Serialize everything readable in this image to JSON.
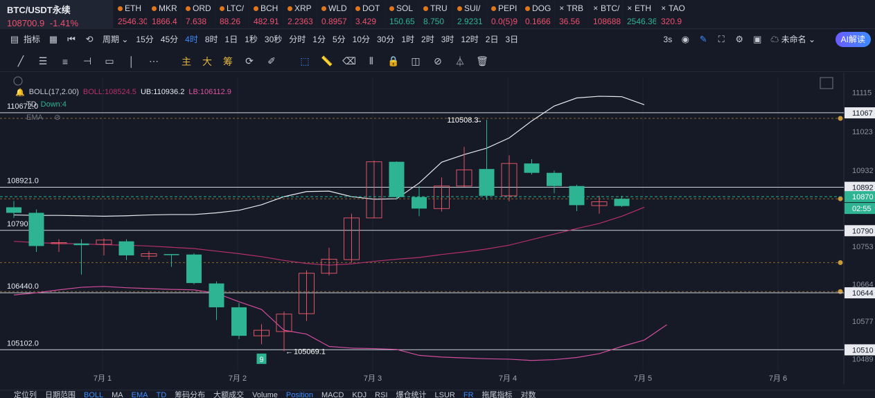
{
  "main_ticker": {
    "symbol": "BTC/USDT永续",
    "price": "108700.9",
    "change": "-1.41%"
  },
  "tickers": [
    {
      "name": "ETH",
      "price": "2546.30",
      "dir": "dn",
      "icon": "coin-icon"
    },
    {
      "name": "MKR",
      "price": "1866.4",
      "dir": "dn",
      "icon": "coin-icon"
    },
    {
      "name": "ORD",
      "price": "7.638",
      "dir": "dn",
      "icon": "coin-icon"
    },
    {
      "name": "LTC/",
      "price": "88.26",
      "dir": "dn",
      "icon": "coin-icon"
    },
    {
      "name": "BCH",
      "price": "482.91",
      "dir": "dn",
      "icon": "coin-icon"
    },
    {
      "name": "XRP",
      "price": "2.2363",
      "dir": "dn",
      "icon": "coin-icon"
    },
    {
      "name": "WLD",
      "price": "0.8957",
      "dir": "dn",
      "icon": "coin-icon"
    },
    {
      "name": "DOT",
      "price": "3.429",
      "dir": "dn",
      "icon": "coin-icon"
    },
    {
      "name": "SOL",
      "price": "150.65",
      "dir": "up",
      "icon": "coin-icon"
    },
    {
      "name": "TRU",
      "price": "8.750",
      "dir": "up",
      "icon": "coin-icon"
    },
    {
      "name": "SUI/",
      "price": "2.9231",
      "dir": "up",
      "icon": "coin-icon"
    },
    {
      "name": "PEPI",
      "price": "0.0(5)9",
      "dir": "dn",
      "icon": "coin-icon"
    },
    {
      "name": "DOG",
      "price": "0.1666",
      "dir": "dn",
      "icon": "coin-icon"
    },
    {
      "name": "TRB",
      "price": "36.56",
      "dir": "dn",
      "icon": "x-icon"
    },
    {
      "name": "BTC/",
      "price": "108688",
      "dir": "dn",
      "icon": "x-icon"
    },
    {
      "name": "ETH",
      "price": "2546.36",
      "dir": "up",
      "icon": "x-icon"
    },
    {
      "name": "TAO",
      "price": "320.9",
      "dir": "dn",
      "icon": "x-icon"
    }
  ],
  "toolbar": {
    "indicator_label": "指标",
    "period_label": "周期",
    "intervals": [
      "15分",
      "45分",
      "4时",
      "8时",
      "1日",
      "1秒",
      "30秒",
      "分时",
      "1分",
      "5分",
      "10分",
      "30分",
      "1时",
      "2时",
      "3时",
      "12时",
      "2日",
      "3日"
    ],
    "active_interval": "4时",
    "right_interval": "3s",
    "layout_name": "未命名",
    "ai_label": "AI解读"
  },
  "draw_tools": {
    "main": "主",
    "big": "大",
    "chips": "筹"
  },
  "legend": {
    "boll_name": "BOLL(17,2.00)",
    "boll_value": "BOLL:108524.5",
    "ub": "UB:110936.2",
    "lb": "LB:106112.9",
    "td_name": "TD",
    "td_value": "Down:4",
    "ema_name": "EMA"
  },
  "colors": {
    "up": "#2fb493",
    "down": "#f0506e",
    "accent": "#3d8bfd",
    "boll_mid": "#b8306b",
    "bands": "#e8eaf0"
  },
  "chart_data": {
    "type": "candlestick",
    "symbol": "BTC/USDT",
    "interval": "4时",
    "ylim": [
      104700,
      111500
    ],
    "x_labels": [
      "7月 1",
      "7月 2",
      "7月 3",
      "7月 4",
      "7月 5",
      "7月 6"
    ],
    "axis_ticks": [
      "11115",
      "11067",
      "11023",
      "10932",
      "10892",
      "10870",
      "10790",
      "10753",
      "10664",
      "10644",
      "10577",
      "10510",
      "10489"
    ],
    "candles": [
      {
        "o": 108450,
        "h": 108600,
        "l": 108200,
        "c": 108320
      },
      {
        "o": 108320,
        "h": 108400,
        "l": 107400,
        "c": 107540
      },
      {
        "o": 107600,
        "h": 107700,
        "l": 107400,
        "c": 107620
      },
      {
        "o": 107600,
        "h": 107700,
        "l": 106870,
        "c": 107560
      },
      {
        "o": 107580,
        "h": 107720,
        "l": 107320,
        "c": 107680
      },
      {
        "o": 107650,
        "h": 107700,
        "l": 107210,
        "c": 107320
      },
      {
        "o": 107300,
        "h": 107420,
        "l": 107220,
        "c": 107360
      },
      {
        "o": 107350,
        "h": 107350,
        "l": 107050,
        "c": 107340
      },
      {
        "o": 107340,
        "h": 107370,
        "l": 106640,
        "c": 106670
      },
      {
        "o": 106660,
        "h": 106710,
        "l": 105800,
        "c": 106100
      },
      {
        "o": 106100,
        "h": 106200,
        "l": 105350,
        "c": 105430
      },
      {
        "o": 105430,
        "h": 105700,
        "l": 105230,
        "c": 105560
      },
      {
        "o": 105530,
        "h": 106000,
        "l": 105069,
        "c": 105940
      },
      {
        "o": 105950,
        "h": 106970,
        "l": 105780,
        "c": 106900
      },
      {
        "o": 106900,
        "h": 107500,
        "l": 106850,
        "c": 107230
      },
      {
        "o": 107220,
        "h": 108300,
        "l": 107150,
        "c": 108200
      },
      {
        "o": 108200,
        "h": 109550,
        "l": 108200,
        "c": 109520
      },
      {
        "o": 109520,
        "h": 109530,
        "l": 108630,
        "c": 108690
      },
      {
        "o": 108690,
        "h": 108950,
        "l": 108240,
        "c": 108420
      },
      {
        "o": 108420,
        "h": 109150,
        "l": 108350,
        "c": 108950
      },
      {
        "o": 108950,
        "h": 109870,
        "l": 108930,
        "c": 109330
      },
      {
        "o": 109350,
        "h": 110508.3,
        "l": 108620,
        "c": 108720
      },
      {
        "o": 108720,
        "h": 109670,
        "l": 108590,
        "c": 109480
      },
      {
        "o": 109480,
        "h": 109580,
        "l": 109220,
        "c": 109260
      },
      {
        "o": 109260,
        "h": 109310,
        "l": 108780,
        "c": 108950
      },
      {
        "o": 108950,
        "h": 108980,
        "l": 108360,
        "c": 108500
      },
      {
        "o": 108490,
        "h": 108720,
        "l": 108300,
        "c": 108580
      },
      {
        "o": 108650,
        "h": 108720,
        "l": 108460,
        "c": 108480
      }
    ],
    "boll_upper": [
      108270,
      108260,
      108260,
      108250,
      108240,
      108250,
      108270,
      108280,
      108280,
      108320,
      108380,
      108510,
      108700,
      108820,
      108830,
      108700,
      108640,
      108650,
      109020,
      109510,
      109690,
      109840,
      110080,
      110480,
      110830,
      111020,
      111060,
      111050,
      110860
    ],
    "boll_mid": [
      107650,
      107620,
      107600,
      107590,
      107570,
      107560,
      107540,
      107510,
      107480,
      107420,
      107360,
      107290,
      107200,
      107130,
      107090,
      107120,
      107180,
      107230,
      107270,
      107340,
      107400,
      107470,
      107560,
      107690,
      107820,
      107950,
      108070,
      108240,
      108450
    ],
    "boll_lower": [
      106390,
      106440,
      106510,
      106570,
      106590,
      106560,
      106540,
      106520,
      106510,
      106430,
      106230,
      106050,
      105560,
      105470,
      105180,
      105140,
      105130,
      105110,
      104970,
      104930,
      104910,
      104890,
      104880,
      104850,
      104870,
      104920,
      105010,
      105180,
      105330,
      105690
    ],
    "levels": [
      {
        "price": "110672.0",
        "style": "solid"
      },
      {
        "price": "108921.0",
        "style": "solid"
      },
      {
        "price": "107907.9",
        "style": "solid"
      },
      {
        "price": "106440.0",
        "style": "solid"
      },
      {
        "price": "105102.0",
        "style": "solid"
      }
    ],
    "annotations": [
      "110508.3",
      "105069.1",
      "9"
    ],
    "current_price_tag": "10870",
    "countdown": "02:55"
  },
  "bottom_bar": [
    "定位列",
    "日期范围",
    "BOLL",
    "MA",
    "EMA",
    "TD",
    "筹码分布",
    "大额成交",
    "Volume",
    "Position",
    "MACD",
    "KDJ",
    "RSI",
    "爆仓统计",
    "LSUR",
    "FR",
    "拖尾指标",
    "对数"
  ]
}
